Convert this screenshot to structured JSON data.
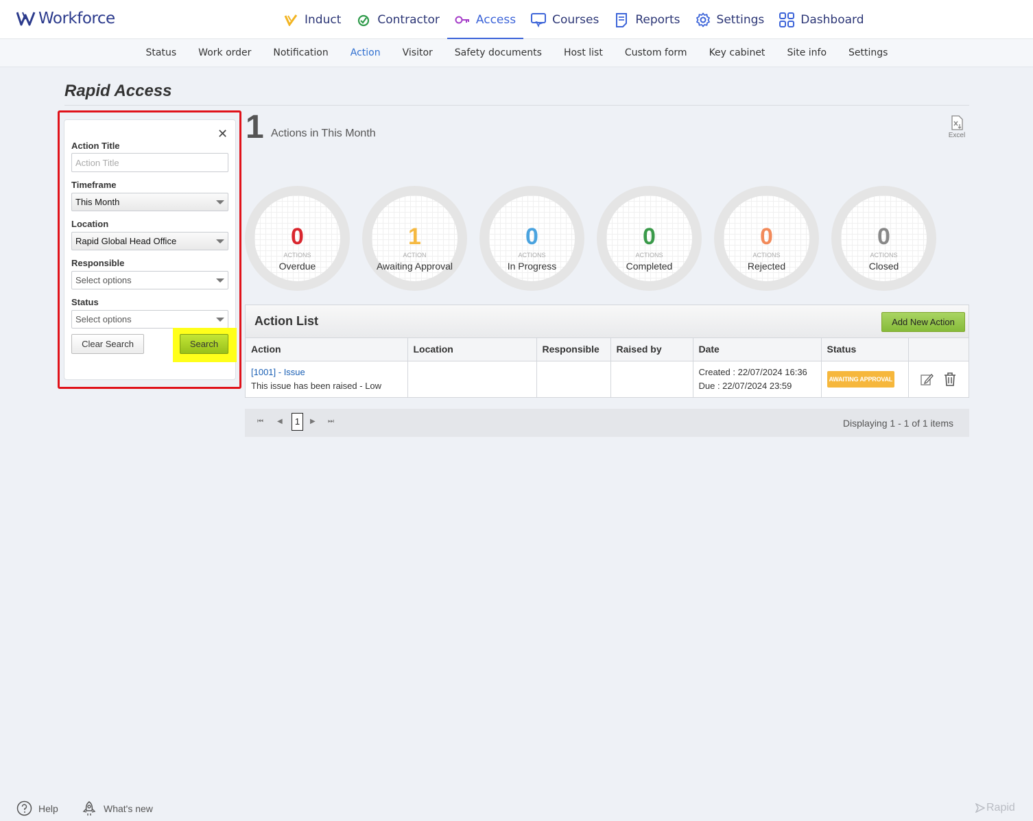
{
  "app": {
    "logo_text": "Workforce"
  },
  "main_nav": [
    {
      "label": "Induct",
      "icon": "induct-icon"
    },
    {
      "label": "Contractor",
      "icon": "contractor-icon"
    },
    {
      "label": "Access",
      "icon": "access-key-icon",
      "active": true
    },
    {
      "label": "Courses",
      "icon": "courses-icon"
    },
    {
      "label": "Reports",
      "icon": "reports-icon"
    },
    {
      "label": "Settings",
      "icon": "gear-icon"
    },
    {
      "label": "Dashboard",
      "icon": "dashboard-grid-icon"
    }
  ],
  "sub_nav": [
    "Status",
    "Work order",
    "Notification",
    "Action",
    "Visitor",
    "Safety documents",
    "Host list",
    "Custom form",
    "Key cabinet",
    "Site info",
    "Settings"
  ],
  "page": {
    "title": "Rapid Access"
  },
  "filter": {
    "action_title_label": "Action Title",
    "action_title_placeholder": "Action Title",
    "action_title_value": "",
    "timeframe_label": "Timeframe",
    "timeframe_value": "This Month",
    "location_label": "Location",
    "location_value": "Rapid Global Head Office",
    "responsible_label": "Responsible",
    "responsible_value": "Select options",
    "status_label": "Status",
    "status_value": "Select options",
    "clear_label": "Clear Search",
    "search_label": "Search",
    "close_symbol": "✕"
  },
  "summary": {
    "count": "1",
    "caption": "Actions in This Month",
    "excel_label": "Excel"
  },
  "stats": [
    {
      "num": "0",
      "unit": "ACTIONS",
      "label": "Overdue",
      "color": "#d9262e"
    },
    {
      "num": "1",
      "unit": "ACTION",
      "label": "Awaiting Approval",
      "color": "#f5b942"
    },
    {
      "num": "0",
      "unit": "ACTIONS",
      "label": "In Progress",
      "color": "#4aa3df"
    },
    {
      "num": "0",
      "unit": "ACTIONS",
      "label": "Completed",
      "color": "#3a9a4a"
    },
    {
      "num": "0",
      "unit": "ACTIONS",
      "label": "Rejected",
      "color": "#f28a5a"
    },
    {
      "num": "0",
      "unit": "ACTIONS",
      "label": "Closed",
      "color": "#888888"
    }
  ],
  "action_list": {
    "title": "Action List",
    "add_label": "Add New Action",
    "columns": [
      "Action",
      "Location",
      "Responsible",
      "Raised by",
      "Date",
      "Status",
      ""
    ],
    "rows": [
      {
        "link": "[1001] - Issue",
        "desc": "This issue has been raised - Low",
        "location": "",
        "responsible": "",
        "raised_by": "",
        "created": "Created : 22/07/2024 16:36",
        "due": "Due : 22/07/2024 23:59",
        "status": "AWAITING APPROVAL"
      }
    ]
  },
  "pager": {
    "current": "1",
    "display": "Displaying 1 - 1 of 1 items"
  },
  "footer": {
    "help": "Help",
    "whats_new": "What's new",
    "brand": "Rapid"
  }
}
